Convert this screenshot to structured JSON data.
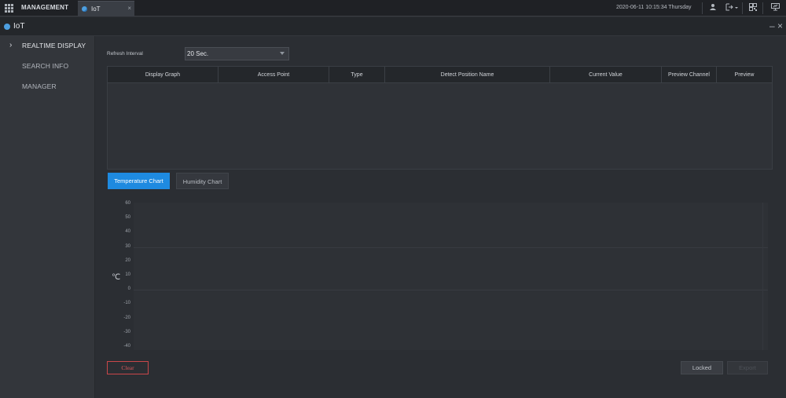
{
  "topbar": {
    "app_title": "MANAGEMENT",
    "tab_label": "IoT",
    "tab_close": "×",
    "datetime": "2020-06-11 10:15:34 Thursday",
    "icons": [
      "user-icon",
      "logout-icon",
      "qr-code-icon",
      "monitor-icon"
    ]
  },
  "subbar": {
    "title": "IoT",
    "minimize": "–",
    "close": "×"
  },
  "sidebar": {
    "items": [
      {
        "label": "REALTIME DISPLAY",
        "active": true
      },
      {
        "label": "SEARCH INFO",
        "active": false
      },
      {
        "label": "MANAGER",
        "active": false
      }
    ]
  },
  "main": {
    "refresh_label": "Refresh Interval",
    "refresh_value": "20 Sec.",
    "table": {
      "columns": [
        "Display Graph",
        "Access Point",
        "Type",
        "Detect Position Name",
        "Current Value",
        "Preview Channel",
        "Preview"
      ],
      "rows": []
    },
    "chart_tabs": [
      "Temperature Chart",
      "Humidity Chart"
    ],
    "buttons": {
      "clear": "Clear",
      "locked": "Locked",
      "export": "Export"
    }
  },
  "chart_data": {
    "type": "line",
    "title": "",
    "xlabel": "",
    "ylabel": "℃",
    "ylim": [
      -40,
      60
    ],
    "yticks": [
      "60",
      "50",
      "40",
      "30",
      "20",
      "10",
      "0",
      "-10",
      "-20",
      "-30",
      "-40"
    ],
    "series": [],
    "grid": true
  },
  "colors": {
    "accent": "#1e8ae0",
    "danger": "#d9585b",
    "background": "#2b2e33"
  }
}
